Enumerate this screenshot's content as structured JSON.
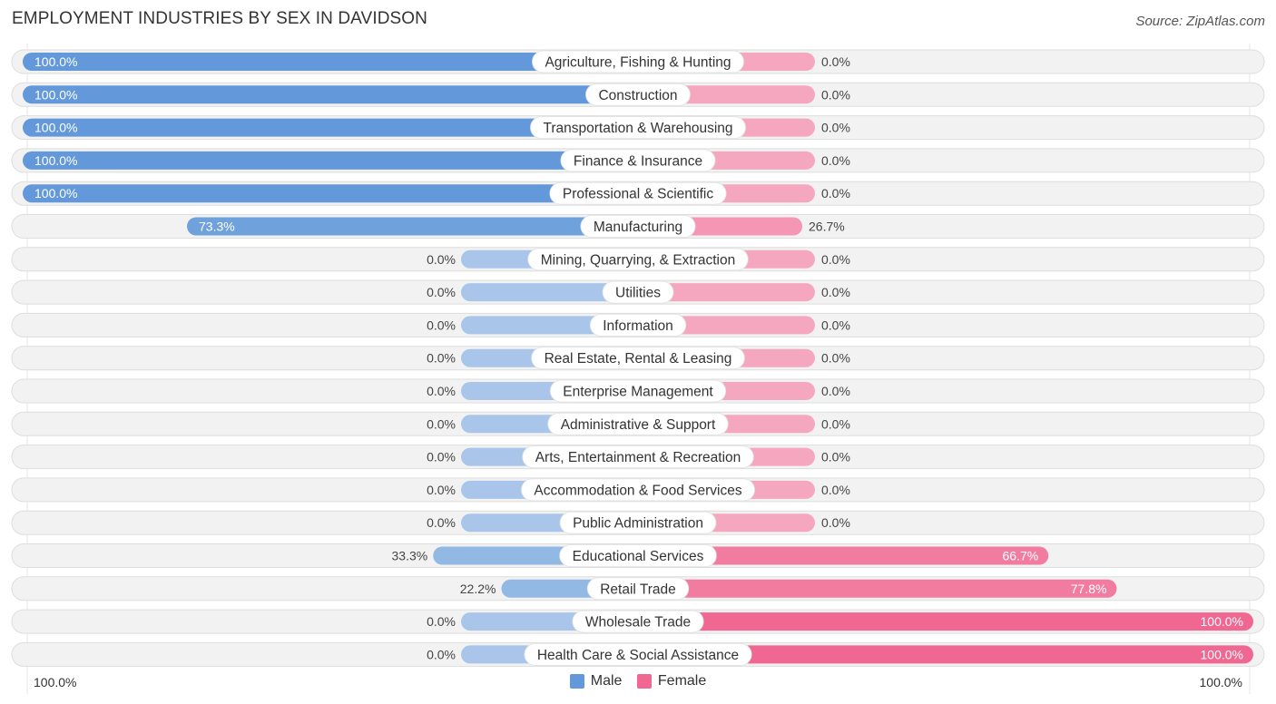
{
  "title": "EMPLOYMENT INDUSTRIES BY SEX IN DAVIDSON",
  "source": "Source: ZipAtlas.com",
  "colors": {
    "male_full": "#6399db",
    "male_light": "#a9c6ea",
    "female_full": "#f06792",
    "female_light": "#f6a7c0",
    "track": "#f2f2f2",
    "track_border": "#dddddd"
  },
  "legend": {
    "male": "Male",
    "female": "Female"
  },
  "axis": {
    "left": "100.0%",
    "right": "100.0%"
  },
  "chart_data": {
    "type": "bar",
    "orientation": "horizontal-diverging",
    "title": "EMPLOYMENT INDUSTRIES BY SEX IN DAVIDSON",
    "xlim": [
      -100,
      100
    ],
    "legend_position": "bottom-center",
    "series": [
      {
        "name": "Male",
        "values": [
          100,
          100,
          100,
          100,
          100,
          73.3,
          0,
          0,
          0,
          0,
          0,
          0,
          0,
          0,
          0,
          33.3,
          22.2,
          0,
          0
        ]
      },
      {
        "name": "Female",
        "values": [
          0,
          0,
          0,
          0,
          0,
          26.7,
          0,
          0,
          0,
          0,
          0,
          0,
          0,
          0,
          0,
          66.7,
          77.8,
          100,
          100
        ]
      }
    ],
    "categories": [
      "Agriculture, Fishing & Hunting",
      "Construction",
      "Transportation & Warehousing",
      "Finance & Insurance",
      "Professional & Scientific",
      "Manufacturing",
      "Mining, Quarrying, & Extraction",
      "Utilities",
      "Information",
      "Real Estate, Rental & Leasing",
      "Enterprise Management",
      "Administrative & Support",
      "Arts, Entertainment & Recreation",
      "Accommodation & Food Services",
      "Public Administration",
      "Educational Services",
      "Retail Trade",
      "Wholesale Trade",
      "Health Care & Social Assistance"
    ],
    "male_labels": [
      "100.0%",
      "100.0%",
      "100.0%",
      "100.0%",
      "100.0%",
      "73.3%",
      "0.0%",
      "0.0%",
      "0.0%",
      "0.0%",
      "0.0%",
      "0.0%",
      "0.0%",
      "0.0%",
      "0.0%",
      "33.3%",
      "22.2%",
      "0.0%",
      "0.0%"
    ],
    "female_labels": [
      "0.0%",
      "0.0%",
      "0.0%",
      "0.0%",
      "0.0%",
      "26.7%",
      "0.0%",
      "0.0%",
      "0.0%",
      "0.0%",
      "0.0%",
      "0.0%",
      "0.0%",
      "0.0%",
      "0.0%",
      "66.7%",
      "77.8%",
      "100.0%",
      "100.0%"
    ]
  }
}
